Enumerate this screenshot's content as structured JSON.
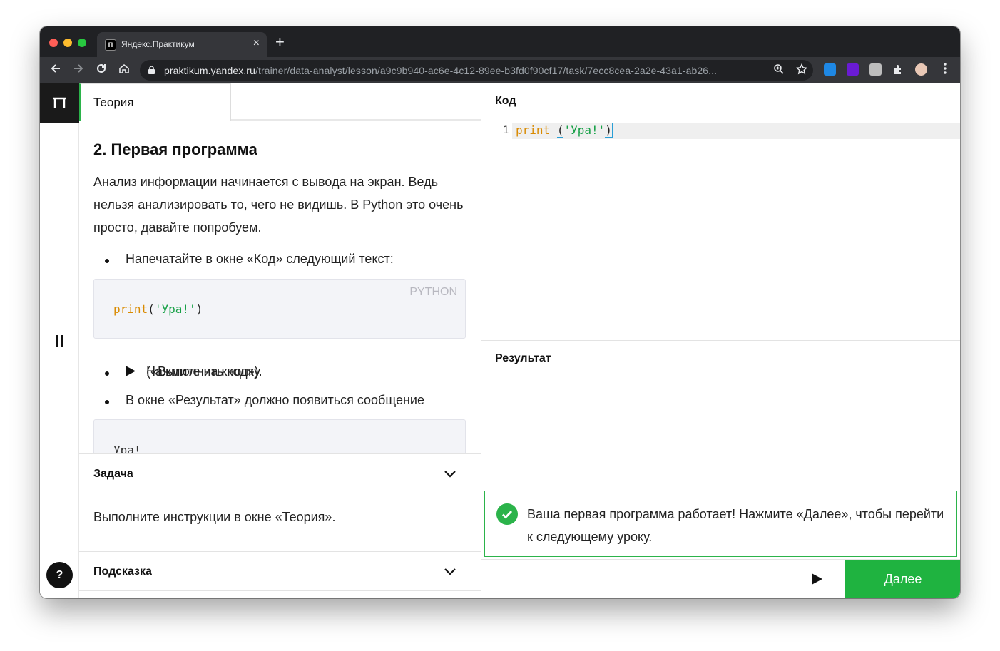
{
  "browser": {
    "tab_title": "Яндекс.Практикум",
    "tab_favicon": "П",
    "tab_close": "×",
    "new_tab": "+",
    "url_host": "praktikum.yandex.ru",
    "url_path": "/trainer/data-analyst/lesson/a9c9b940-ac6e-4c12-89ee-b3fd0f90cf17/task/7ecc8cea-2a2e-43a1-ab26...",
    "window_colors": {
      "close": "#ff5f57",
      "minimize": "#febc2e",
      "maximize": "#28c840"
    }
  },
  "sidebar": {
    "help_label": "?"
  },
  "theory": {
    "tab_label": "Теория",
    "heading": "2. Первая программа",
    "paragraph": "Анализ информации начинается с вывода на экран. Ведь нельзя анализировать то, чего не видишь. В Python это очень просто, давайте попробуем.",
    "bullet1": "Напечатайте в окне «Код» следующий текст:",
    "code_lang": "PYTHON",
    "code_fn": "print",
    "code_open": "(",
    "code_str": "'Ура!'",
    "code_close": ")",
    "bullet2_prefix": "Нажмите на кнопку",
    "bullet2_suffix": "(«Выполнить код»).",
    "bullet3": "В окне «Результат» должно появиться сообщение",
    "output_text": "Ура!"
  },
  "task": {
    "title": "Задача",
    "text": "Выполните инструкции в окне «Теория»."
  },
  "hint": {
    "title": "Подсказка"
  },
  "editor": {
    "title": "Код",
    "line_number": "1",
    "code_fn": "print",
    "code_space": " ",
    "code_open": "(",
    "code_str": "'Ура!'",
    "code_close": ")"
  },
  "result": {
    "title": "Результат",
    "success_message": "Ваша первая программа работает! Нажмите «Далее», чтобы перейти к следующему уроку."
  },
  "actions": {
    "next_label": "Далее"
  },
  "colors": {
    "accent_green": "#1fb340",
    "code_function": "#d98a00",
    "code_string": "#16a046"
  }
}
